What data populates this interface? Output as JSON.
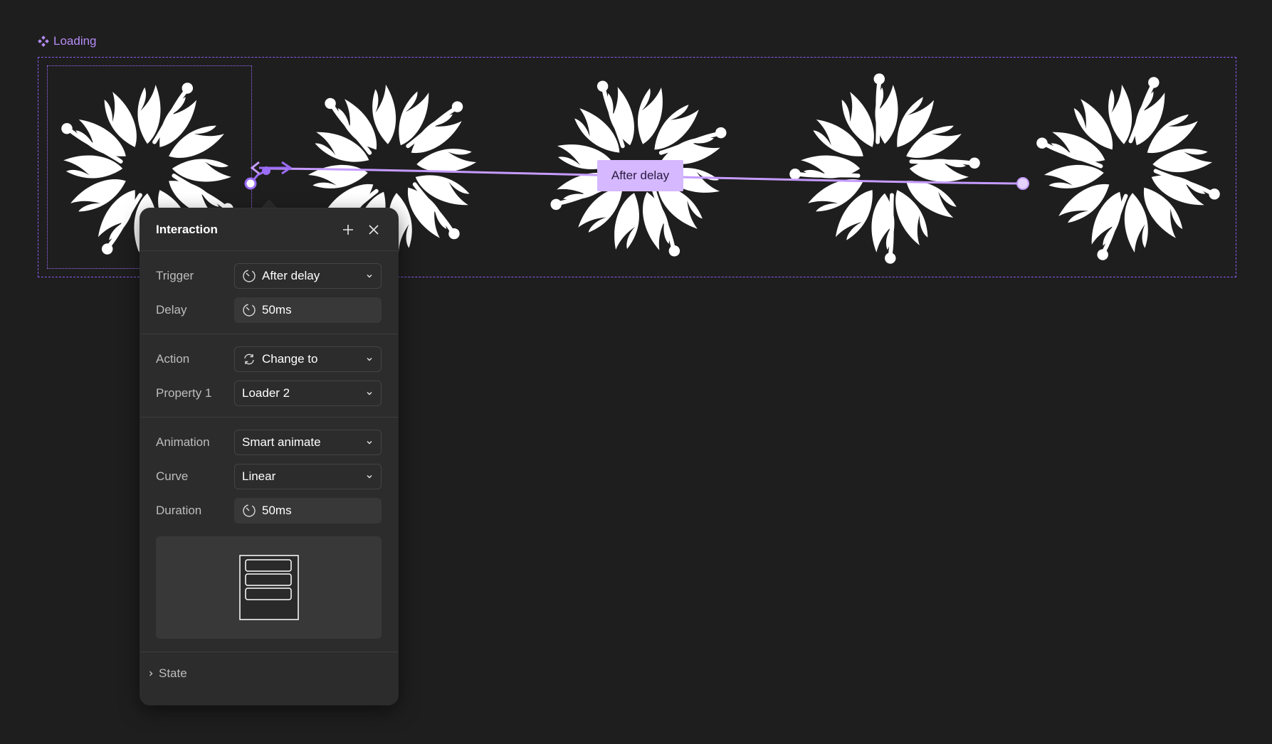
{
  "canvas": {
    "frame_label": "Loading",
    "connection_label": "After delay"
  },
  "panel": {
    "title": "Interaction",
    "trigger": {
      "label": "Trigger",
      "value": "After delay"
    },
    "delay": {
      "label": "Delay",
      "value": "50ms"
    },
    "action": {
      "label": "Action",
      "value": "Change to"
    },
    "property": {
      "label": "Property 1",
      "value": "Loader 2"
    },
    "animation": {
      "label": "Animation",
      "value": "Smart animate"
    },
    "curve": {
      "label": "Curve",
      "value": "Linear"
    },
    "duration": {
      "label": "Duration",
      "value": "50ms"
    },
    "state_label": "State"
  },
  "colors": {
    "accent": "#9b6cf7",
    "connection_label_bg": "#d5b8ff",
    "canvas_bg": "#1e1e1e",
    "panel_bg": "#2c2c2c"
  }
}
